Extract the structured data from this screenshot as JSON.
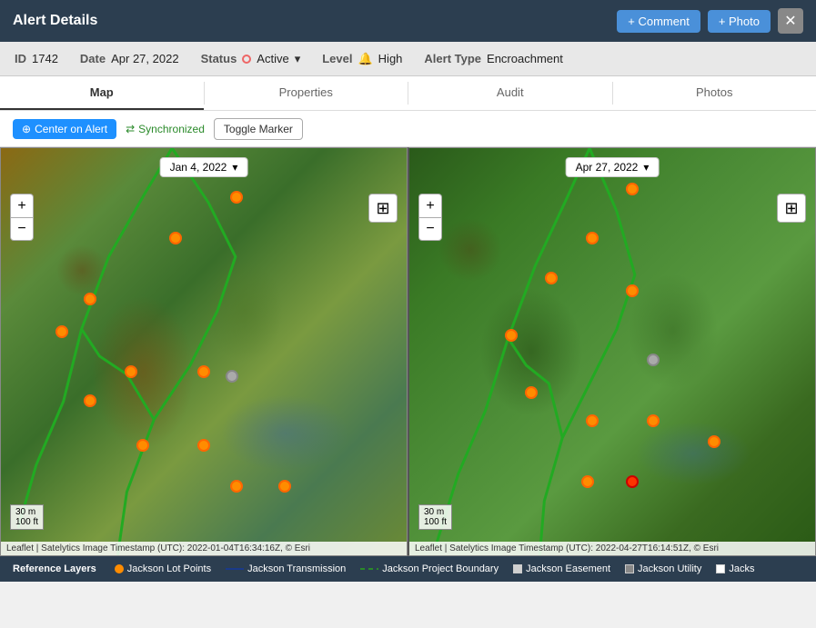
{
  "header": {
    "title": "Alert Details",
    "comment_label": "+ Comment",
    "photo_label": "+ Photo",
    "close_label": "×"
  },
  "meta": {
    "id_label": "ID",
    "id_value": "1742",
    "date_label": "Date",
    "date_value": "Apr 27, 2022",
    "status_label": "Status",
    "status_value": "Active",
    "level_label": "Level",
    "level_value": "High",
    "alert_type_label": "Alert Type",
    "alert_type_value": "Encroachment"
  },
  "tabs": [
    {
      "label": "Map",
      "active": true
    },
    {
      "label": "Properties",
      "active": false
    },
    {
      "label": "Audit",
      "active": false
    },
    {
      "label": "Photos",
      "active": false
    }
  ],
  "toolbar": {
    "center_label": "Center on Alert",
    "sync_label": "Synchronized",
    "toggle_label": "Toggle Marker"
  },
  "maps": [
    {
      "date": "Jan 4, 2022",
      "attribution": "Leaflet | Satelytics Image Timestamp (UTC): 2022-01-04T16:34:16Z, © Esri",
      "scale_m": "30 m",
      "scale_ft": "100 ft"
    },
    {
      "date": "Apr 27, 2022",
      "attribution": "Leaflet | Satelytics Image Timestamp (UTC): 2022-04-27T16:14:51Z, © Esri",
      "scale_m": "30 m",
      "scale_ft": "100 ft"
    }
  ],
  "ref_layers": {
    "label": "Reference Layers",
    "items": [
      {
        "type": "dot",
        "color": "#ff8c00",
        "label": "Jackson Lot Points"
      },
      {
        "type": "line",
        "color": "#1a3a8a",
        "label": "Jackson Transmission"
      },
      {
        "type": "dashed",
        "color": "#2a8a2a",
        "label": "Jackson Project Boundary"
      },
      {
        "type": "square",
        "color": "#d0d0d0",
        "label": "Jackson Easement"
      },
      {
        "type": "dot",
        "color": "#888",
        "label": "Jackson Utility"
      },
      {
        "type": "square",
        "color": "#fff",
        "label": "Jacks"
      }
    ]
  },
  "zoom": {
    "plus": "+",
    "minus": "−"
  },
  "layers_icon": "⊞"
}
